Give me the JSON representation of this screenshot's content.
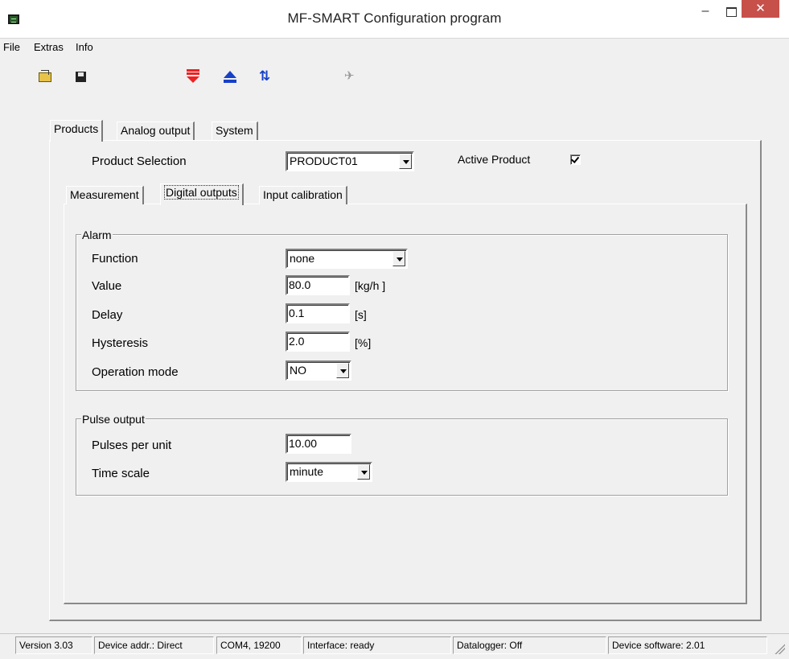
{
  "window": {
    "title": "MF-SMART Configuration program",
    "minimize": "–",
    "close": "✕"
  },
  "menu": [
    "File",
    "Extras",
    "Info"
  ],
  "toolbar": {
    "icons": [
      "open-folder-icon",
      "save-disk-icon",
      "download-to-device-icon",
      "upload-from-device-icon",
      "sync-icon",
      "connect-icon"
    ]
  },
  "tabs_main": [
    {
      "label": "Products",
      "active": true,
      "accel": "P"
    },
    {
      "label": "Analog output",
      "active": false,
      "accel": "n"
    },
    {
      "label": "System",
      "active": false,
      "accel": "S"
    }
  ],
  "product": {
    "selection_label": "Product Selection",
    "selection_value": "PRODUCT01",
    "active_label": "Active Product",
    "active_checked": true
  },
  "tabs_sub": [
    {
      "label": "Measurement",
      "active": false
    },
    {
      "label": "Digital outputs",
      "active": true
    },
    {
      "label": "Input calibration",
      "active": false
    }
  ],
  "alarm": {
    "title": "Alarm",
    "function_label": "Function",
    "function_value": "none",
    "value_label": "Value",
    "value_value": "80.0",
    "value_unit": "[kg/h ]",
    "delay_label": "Delay",
    "delay_value": "0.1",
    "delay_unit": "[s]",
    "hysteresis_label": "Hysteresis",
    "hysteresis_value": "2.0",
    "hysteresis_unit": "[%]",
    "opmode_label": "Operation mode",
    "opmode_value": "NO"
  },
  "pulse": {
    "title": "Pulse output",
    "ppu_label": "Pulses per unit",
    "ppu_value": "10.00",
    "timescale_label": "Time scale",
    "timescale_value": "minute"
  },
  "status": {
    "version": "Version 3.03",
    "device_addr": "Device addr.: Direct",
    "port": "COM4,  19200",
    "interface": "Interface: ready",
    "datalogger": "Datalogger: Off",
    "device_software": "Device software: 2.01"
  },
  "colors": {
    "close_button": "#c7504b",
    "download_arrow": "#e22222",
    "upload_arrow": "#1540c8"
  }
}
